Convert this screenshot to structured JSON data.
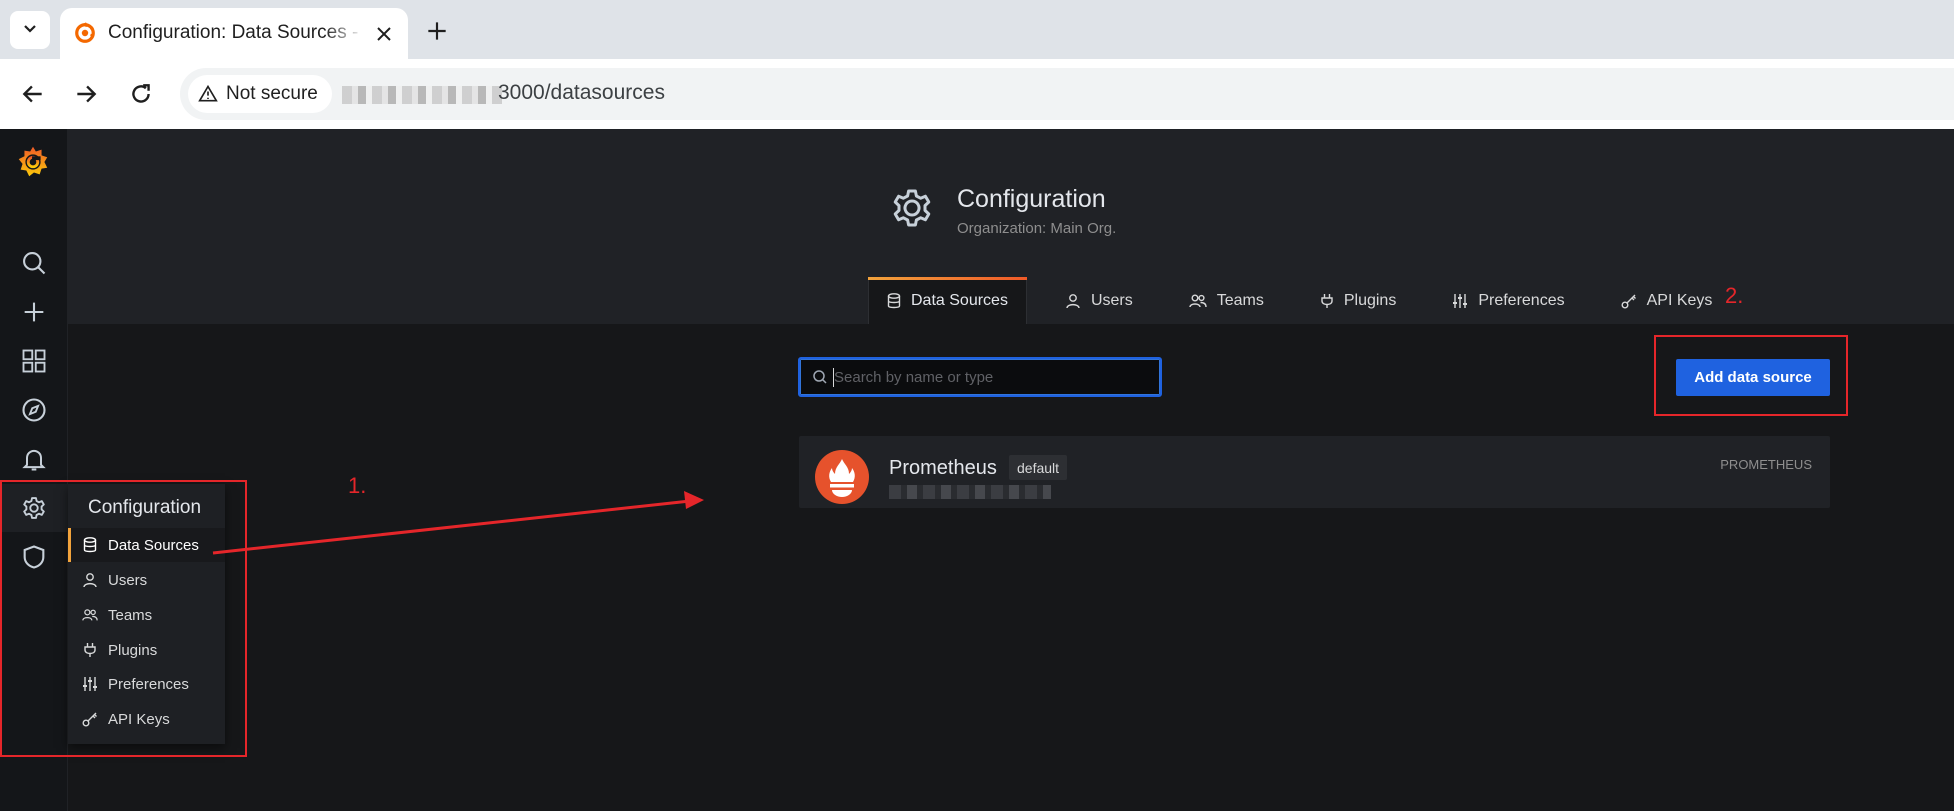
{
  "browser": {
    "tab_title": "Configuration: Data Sources - Grafana",
    "security_label": "Not secure",
    "url_visible": "3000/datasources"
  },
  "sidemenu": {
    "items": [
      "search-icon",
      "plus-icon",
      "dashboards-icon",
      "explore-icon",
      "alerting-icon",
      "gear-icon",
      "shield-icon"
    ],
    "flyout": {
      "header": "Configuration",
      "items": [
        {
          "label": "Data Sources",
          "icon": "database-icon",
          "active": true
        },
        {
          "label": "Users",
          "icon": "user-icon"
        },
        {
          "label": "Teams",
          "icon": "users-icon"
        },
        {
          "label": "Plugins",
          "icon": "plug-icon"
        },
        {
          "label": "Preferences",
          "icon": "sliders-icon"
        },
        {
          "label": "API Keys",
          "icon": "key-icon"
        }
      ]
    }
  },
  "page": {
    "title": "Configuration",
    "subtitle": "Organization: Main Org.",
    "tabs": [
      {
        "label": "Data Sources",
        "icon": "database-icon",
        "active": true
      },
      {
        "label": "Users",
        "icon": "user-icon"
      },
      {
        "label": "Teams",
        "icon": "users-icon"
      },
      {
        "label": "Plugins",
        "icon": "plug-icon"
      },
      {
        "label": "Preferences",
        "icon": "sliders-icon"
      },
      {
        "label": "API Keys",
        "icon": "key-icon"
      }
    ]
  },
  "search": {
    "placeholder": "Search by name or type",
    "value": ""
  },
  "add_button": "Add data source",
  "datasources": [
    {
      "name": "Prometheus",
      "badge": "default",
      "type": "PROMETHEUS"
    }
  ],
  "annotations": {
    "step1": "1.",
    "step2": "2.",
    "color": "#e5262a"
  },
  "colors": {
    "accent": "#f2a33c",
    "primary_button": "#1f62e0",
    "background": "#161719",
    "panel": "#202226"
  }
}
